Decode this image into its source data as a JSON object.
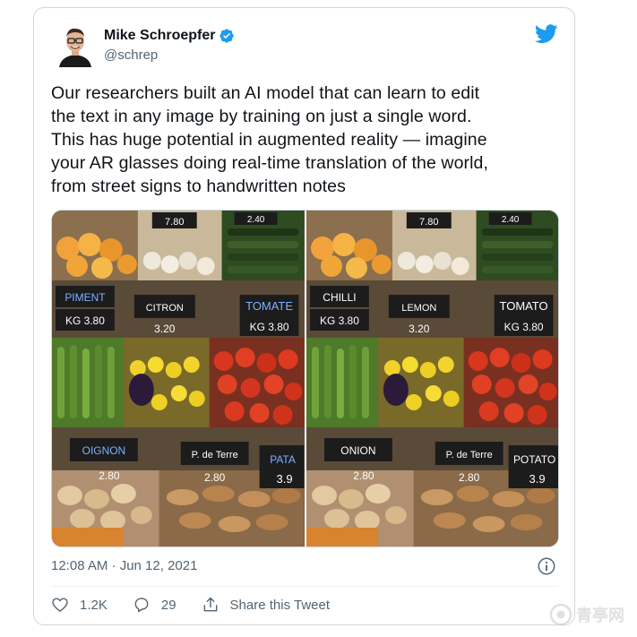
{
  "tweet": {
    "author_name": "Mike Schroepfer",
    "handle": "@schrep",
    "text": "Our researchers built an AI model that can learn to edit\nthe text in any image by training on just a single word.\nThis has huge potential in augmented reality — imagine\nyour AR glasses doing real-time translation of the world,\nfrom street signs to handwritten notes",
    "timestamp": "12:08 AM · Jun 12, 2021",
    "likes": "1.2K",
    "replies": "29",
    "share_label": "Share this Tweet"
  },
  "images": {
    "left": {
      "signs": [
        "PIMENT",
        "CITRON",
        "TOMATE",
        "OIGNON",
        "P. de Terre",
        "PATA"
      ],
      "prices": [
        "KG 3.80",
        "3.20",
        "KG 3.80",
        "2.80",
        "2.80",
        "3.9"
      ],
      "top_prices": [
        "7.80",
        "2.40"
      ]
    },
    "right": {
      "signs": [
        "CHILLI",
        "LEMON",
        "TOMATO",
        "ONION",
        "P. de Terre",
        "POTATO"
      ],
      "prices": [
        "KG 3.80",
        "3.20",
        "KG 3.80",
        "2.80",
        "2.80",
        "3.9"
      ],
      "top_prices": [
        "7.80",
        "2.40"
      ]
    }
  },
  "watermark": {
    "text": "青亭网"
  },
  "colors": {
    "twitter_blue": "#1d9bf0",
    "secondary_text": "#536471",
    "border": "#cfd9de"
  },
  "icons": [
    "verified-badge-icon",
    "twitter-bird-icon",
    "info-icon",
    "heart-icon",
    "reply-icon",
    "share-icon"
  ]
}
